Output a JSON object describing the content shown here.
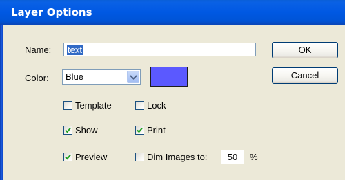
{
  "window": {
    "title": "Layer Options"
  },
  "name_field": {
    "label": "Name:",
    "value": "text"
  },
  "color_field": {
    "label": "Color:",
    "selected": "Blue",
    "swatch_color": "#5b59ff"
  },
  "buttons": {
    "ok": "OK",
    "cancel": "Cancel"
  },
  "options": {
    "template": {
      "label": "Template",
      "checked": false
    },
    "lock": {
      "label": "Lock",
      "checked": false
    },
    "show": {
      "label": "Show",
      "checked": true
    },
    "print": {
      "label": "Print",
      "checked": true
    },
    "preview": {
      "label": "Preview",
      "checked": true
    },
    "dim_images": {
      "label": "Dim Images to:",
      "checked": false,
      "value": "50",
      "unit": "%"
    }
  },
  "colors": {
    "titlebar": "#0058e3",
    "dialog_bg": "#ece9d8",
    "selection": "#316ac5",
    "check": "#21a121"
  }
}
